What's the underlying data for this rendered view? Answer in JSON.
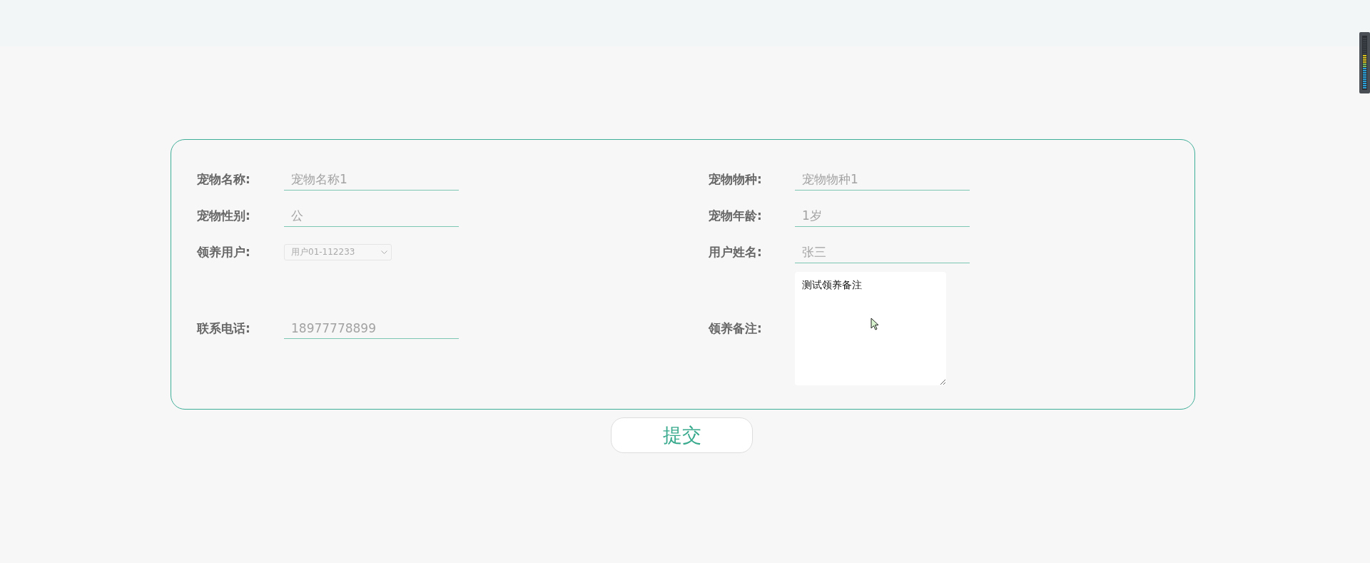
{
  "form": {
    "left_column": [
      {
        "label": "宠物名称:",
        "kind": "text",
        "placeholder": "宠物名称1"
      },
      {
        "label": "宠物性别:",
        "kind": "text",
        "placeholder": "公"
      },
      {
        "label": "领养用户:",
        "kind": "select",
        "value": "用户01-112233",
        "disabled": true
      },
      {
        "label": "联系电话:",
        "kind": "text",
        "placeholder": "18977778899"
      }
    ],
    "right_column": [
      {
        "label": "宠物物种:",
        "kind": "text",
        "placeholder": "宠物物种1"
      },
      {
        "label": "宠物年龄:",
        "kind": "text",
        "placeholder": "1岁"
      },
      {
        "label": "用户姓名:",
        "kind": "text",
        "placeholder": "张三"
      },
      {
        "label": "领养备注:",
        "kind": "textarea",
        "value": "测试领养备注"
      }
    ]
  },
  "submit_button": {
    "label": "提交"
  }
}
